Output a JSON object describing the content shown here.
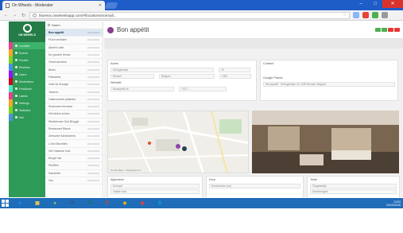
{
  "browser": {
    "tab_title": "On Wheels - Moderator",
    "url": "bluemix.onwheelsapp.com/#/locations/normal/..."
  },
  "rail": {
    "brand": "ON WHEELS",
    "items": [
      {
        "label": "Locaties"
      },
      {
        "label": "Events"
      },
      {
        "label": "Routes"
      },
      {
        "label": "Reviews"
      },
      {
        "label": "Users"
      },
      {
        "label": "Moderators"
      },
      {
        "label": "Feedback"
      },
      {
        "label": "Labels"
      },
      {
        "label": "Settings"
      },
      {
        "label": "Statistics"
      },
      {
        "label": "Info"
      }
    ],
    "stripe_colors": [
      "#e83e8c",
      "#f5a623",
      "#7ed321",
      "#4a90e2",
      "#9013fe",
      "#d0021b",
      "#50e3c2"
    ]
  },
  "list": {
    "header": "Naam",
    "rows": [
      {
        "name": "Bon appétit",
        "meta": "24/10/2016",
        "active": true
      },
      {
        "name": "Pizza verdalen",
        "meta": "24/10/2016"
      },
      {
        "name": "Albert's café",
        "meta": "24/10/2016"
      },
      {
        "name": "De gouden leeuw",
        "meta": "24/10/2016"
      },
      {
        "name": "Great wonders",
        "meta": "24/10/2016"
      },
      {
        "name": "Bistro",
        "meta": "24/10/2016"
      },
      {
        "name": "Patisserie",
        "meta": "24/10/2016"
      },
      {
        "name": "Cafe du Bocage",
        "meta": "24/10/2016"
      },
      {
        "name": "Taverne",
        "meta": "24/10/2016"
      },
      {
        "name": "Gastronomie platanes",
        "meta": "24/10/2016"
      },
      {
        "name": "Sneeuwen terrasse",
        "meta": "24/10/2016"
      },
      {
        "name": "Het kleine zuiden",
        "meta": "24/10/2016"
      },
      {
        "name": "Steakhouse Oud Brugge",
        "meta": "24/10/2016"
      },
      {
        "name": "Restaurant Blauw",
        "meta": "24/10/2016"
      },
      {
        "name": "Zeeuwse Sandwiches",
        "meta": "24/10/2016"
      },
      {
        "name": "L'Ami Bruxelles",
        "meta": "24/10/2016"
      },
      {
        "name": "Het Vlaamse huis",
        "meta": "24/10/2016"
      },
      {
        "name": "Burger bar",
        "meta": "24/10/2016"
      },
      {
        "name": "Shuffles",
        "meta": "24/10/2016"
      },
      {
        "name": "Sandwich",
        "meta": "24/10/2016"
      },
      {
        "name": "Vos",
        "meta": "24/10/2016"
      }
    ]
  },
  "venue": {
    "title": "Bon appétit",
    "action_colors": [
      "#4caf50",
      "#4caf50",
      "#e53935",
      "#e53935"
    ],
    "address_label": "Adres",
    "address_fields": [
      "Hertogenlaan",
      "15",
      "Brussel",
      "Belgium",
      "1000"
    ],
    "website_label": "Website",
    "website_fields": [
      "Bonappetit.be",
      "+32 2 ..."
    ],
    "contact_label": "Contact",
    "places_label": "Google Places",
    "places_value": "Bon appétit · Hertogenlaan 15, 1000 Brussel, Belgium",
    "map_caption": "Google Maps · Kaartgegevens",
    "section_labels": [
      "Algemeen",
      "Deur",
      "Toilet"
    ],
    "checks": [
      "Drempel",
      "Vlakke vloer"
    ],
    "door_width": "Deurbreedte (cm)",
    "toilet_checks": [
      "Toegankelijk",
      "Steunbeugels"
    ]
  },
  "taskbar": {
    "time": "13:53",
    "date": "24/10/2016",
    "apps": [
      {
        "glyph": "e",
        "color": "#1e90ff"
      },
      {
        "glyph": "▦",
        "color": "#f2c94c"
      },
      {
        "glyph": "●",
        "color": "#9fd355"
      },
      {
        "glyph": "W",
        "color": "#2b5797"
      },
      {
        "glyph": "X",
        "color": "#1e7145"
      },
      {
        "glyph": "P",
        "color": "#d04423"
      },
      {
        "glyph": "◆",
        "color": "#f4b400"
      },
      {
        "glyph": "◉",
        "color": "#db4437"
      },
      {
        "glyph": "S",
        "color": "#00aff0"
      }
    ]
  }
}
